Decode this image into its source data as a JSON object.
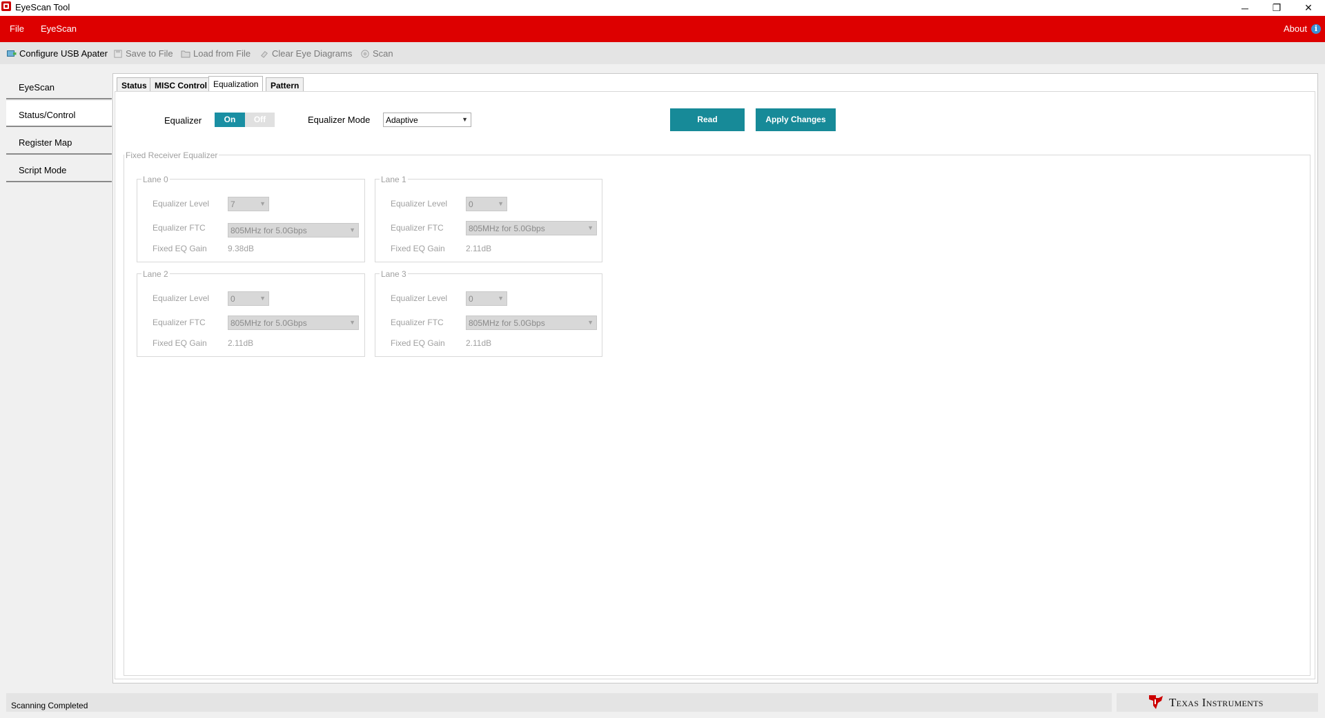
{
  "window": {
    "title": "EyeScan Tool",
    "controls": {
      "minimize": "─",
      "restore": "❐",
      "close": "✕"
    }
  },
  "menu": {
    "items": [
      "File",
      "EyeScan"
    ],
    "about_label": "About",
    "about_icon": "i",
    "bar_color": "#dd0000"
  },
  "toolbar": {
    "configure_label": "Configure USB Apater",
    "save_label": "Save to File",
    "load_label": "Load from File",
    "clear_label": "Clear Eye Diagrams",
    "scan_label": "Scan"
  },
  "sidebar": {
    "items": [
      {
        "label": "EyeScan",
        "active": false
      },
      {
        "label": "Status/Control",
        "active": true
      },
      {
        "label": "Register Map",
        "active": false
      },
      {
        "label": "Script Mode",
        "active": false
      }
    ]
  },
  "tabs": [
    {
      "label": "Status",
      "active": false
    },
    {
      "label": "MISC Control",
      "active": false
    },
    {
      "label": "Equalization",
      "active": true
    },
    {
      "label": "Pattern",
      "active": false
    }
  ],
  "equalization": {
    "equalizer_label": "Equalizer",
    "toggle_on": "On",
    "toggle_off": "Off",
    "mode_label": "Equalizer Mode",
    "mode_value": "Adaptive",
    "read_button": "Read",
    "apply_button": "Apply Changes",
    "accent_color": "#178a98",
    "fixed_group_title": "Fixed Receiver Equalizer",
    "field_labels": {
      "level": "Equalizer Level",
      "ftc": "Equalizer FTC",
      "gain": "Fixed EQ Gain"
    },
    "lanes": [
      {
        "title": "Lane 0",
        "level": "7",
        "ftc": "805MHz for 5.0Gbps",
        "gain": "9.38dB"
      },
      {
        "title": "Lane 1",
        "level": "0",
        "ftc": "805MHz for 5.0Gbps",
        "gain": "2.11dB"
      },
      {
        "title": "Lane 2",
        "level": "0",
        "ftc": "805MHz for 5.0Gbps",
        "gain": "2.11dB"
      },
      {
        "title": "Lane 3",
        "level": "0",
        "ftc": "805MHz for 5.0Gbps",
        "gain": "2.11dB"
      }
    ]
  },
  "status": {
    "text": "Scanning Completed",
    "brand": "Texas Instruments",
    "brand_color": "#cc0000"
  }
}
